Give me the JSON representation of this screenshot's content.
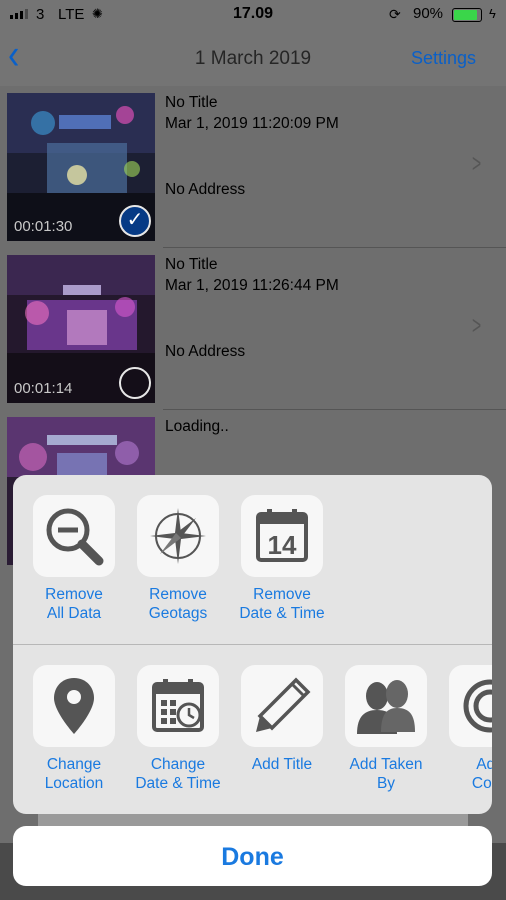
{
  "status": {
    "carrier": "3",
    "network": "LTE",
    "time": "17.09",
    "battery_pct": "90%",
    "battery_level": 0.9
  },
  "nav": {
    "title": "1 March 2019",
    "settings_label": "Settings"
  },
  "rows": [
    {
      "title": "No Title",
      "date": "Mar 1, 2019 11:20:09 PM",
      "address": "No Address",
      "duration": "00:01:30",
      "selected": true
    },
    {
      "title": "No Title",
      "date": "Mar 1, 2019 11:26:44 PM",
      "address": "No Address",
      "duration": "00:01:14",
      "selected": false
    },
    {
      "title": "Loading..",
      "date": "",
      "address": "",
      "duration": "",
      "selected": false
    }
  ],
  "sheet": {
    "row1": [
      {
        "label": "Remove\nAll Data",
        "icon": "magnifier-minus-icon"
      },
      {
        "label": "Remove\nGeotags",
        "icon": "compass-icon"
      },
      {
        "label": "Remove\nDate & Time",
        "icon": "calendar-14-icon",
        "day": "14"
      }
    ],
    "row2": [
      {
        "label": "Change\nLocation",
        "icon": "location-pin-icon"
      },
      {
        "label": "Change\nDate & Time",
        "icon": "calendar-clock-icon"
      },
      {
        "label": "Add Title",
        "icon": "pencil-icon"
      },
      {
        "label": "Add Taken\nBy",
        "icon": "people-icon"
      },
      {
        "label": "Add\nCopy",
        "icon": "copyright-icon"
      }
    ]
  },
  "done_label": "Done"
}
